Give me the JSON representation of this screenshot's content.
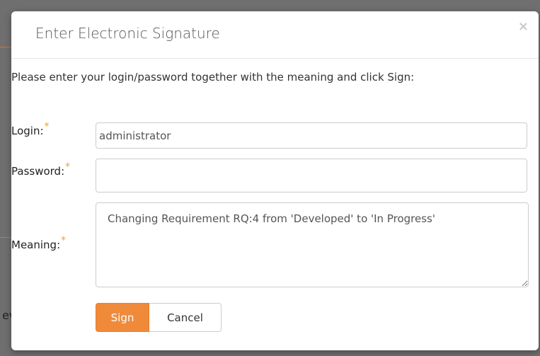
{
  "backdrop": {
    "partial_text": "ev"
  },
  "dialog": {
    "title": "Enter Electronic Signature",
    "close_glyph": "×",
    "instructions": "Please enter your login/password together with the meaning and click Sign:",
    "required_marker": "*",
    "login": {
      "label": "Login:",
      "value": "administrator"
    },
    "password": {
      "label": "Password:",
      "value": ""
    },
    "meaning": {
      "label": "Meaning:",
      "value": "Changing Requirement RQ:4 from 'Developed' to 'In Progress'"
    },
    "buttons": {
      "sign": "Sign",
      "cancel": "Cancel"
    }
  },
  "colors": {
    "accent": "#f08a3b",
    "required": "#f0a030",
    "overlay": "#6f6f6f"
  },
  "icons": {
    "close": "close-icon"
  }
}
